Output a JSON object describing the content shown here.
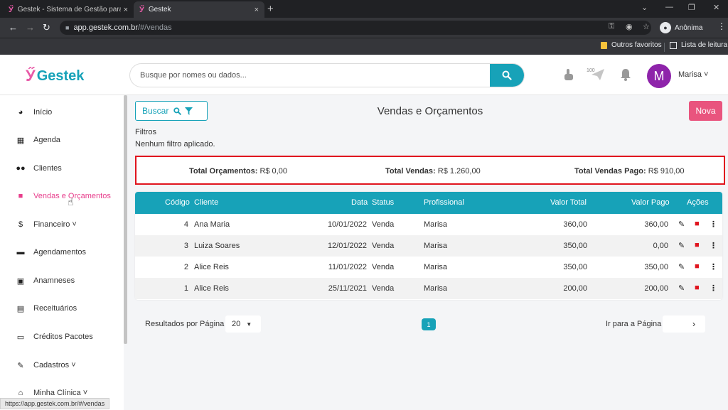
{
  "browser": {
    "tabs": [
      {
        "title": "Gestek - Sistema de Gestão para",
        "close": "×"
      },
      {
        "title": "Gestek",
        "close": "×"
      }
    ],
    "new_tab": "+",
    "url_host": "app.gestek.com.br",
    "url_path": "/#/vendas",
    "profile": "Anônima",
    "bookmarks": {
      "other_favorites": "Outros favoritos",
      "reading_list": "Lista de leitura"
    },
    "status_url": "https://app.gestek.com.br/#/vendas"
  },
  "header": {
    "logo": "Gestek",
    "search_placeholder": "Busque por nomes ou dados...",
    "notification_badge": "100",
    "avatar_letter": "M",
    "user_name": "Marisa ˅"
  },
  "sidebar": {
    "items": [
      {
        "label": "Início",
        "icon": "dashboard-icon"
      },
      {
        "label": "Agenda",
        "icon": "calendar-icon"
      },
      {
        "label": "Clientes",
        "icon": "users-icon"
      },
      {
        "label": "Vendas e Orçamentos",
        "icon": "shopping-bag-icon"
      },
      {
        "label": "Financeiro ˅",
        "icon": "dollar-icon"
      },
      {
        "label": "Agendamentos",
        "icon": "calendar-check-icon"
      },
      {
        "label": "Anamneses",
        "icon": "id-card-icon"
      },
      {
        "label": "Receituários",
        "icon": "file-icon"
      },
      {
        "label": "Créditos Pacotes",
        "icon": "credit-card-icon"
      },
      {
        "label": "Cadastros ˅",
        "icon": "edit-icon"
      },
      {
        "label": "Minha Clínica ˅",
        "icon": "home-icon"
      }
    ]
  },
  "main": {
    "search_button": "Buscar",
    "title": "Vendas e Orçamentos",
    "new_button": "Nova",
    "filters_label": "Filtros",
    "filters_value": "Nenhum filtro aplicado.",
    "totals": {
      "budgets_label": "Total Orçamentos:",
      "budgets_value": "R$ 0,00",
      "sales_label": "Total Vendas:",
      "sales_value": "R$ 1.260,00",
      "paid_label": "Total Vendas Pago:",
      "paid_value": "R$ 910,00"
    },
    "table": {
      "headers": {
        "code": "Código",
        "client": "Cliente",
        "date": "Data",
        "status": "Status",
        "professional": "Profissional",
        "total": "Valor Total",
        "paid": "Valor Pago",
        "actions": "Ações"
      },
      "rows": [
        {
          "code": "4",
          "client": "Ana Maria",
          "date": "10/01/2022",
          "status": "Venda",
          "professional": "Marisa",
          "total": "360,00",
          "paid": "360,00"
        },
        {
          "code": "3",
          "client": "Luiza Soares",
          "date": "12/01/2022",
          "status": "Venda",
          "professional": "Marisa",
          "total": "350,00",
          "paid": "0,00"
        },
        {
          "code": "2",
          "client": "Alice Reis",
          "date": "11/01/2022",
          "status": "Venda",
          "professional": "Marisa",
          "total": "350,00",
          "paid": "350,00"
        },
        {
          "code": "1",
          "client": "Alice Reis",
          "date": "25/11/2021",
          "status": "Venda",
          "professional": "Marisa",
          "total": "200,00",
          "paid": "200,00"
        }
      ]
    },
    "pagination": {
      "per_page_label": "Resultados por Página",
      "per_page_value": "20",
      "current_page": "1",
      "goto_label": "Ir para a Página"
    }
  },
  "colors": {
    "accent": "#17a2b8",
    "brand_pink": "#e85aa7",
    "new_button": "#e9547e",
    "highlight_border": "#e0141e",
    "avatar": "#8e24aa"
  }
}
